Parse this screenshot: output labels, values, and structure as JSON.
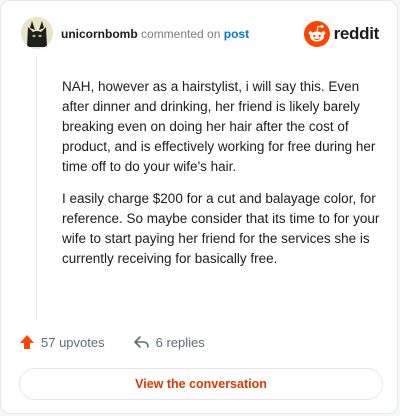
{
  "header": {
    "username": "unicornbomb",
    "action_text": "commented on",
    "post_link_label": "post",
    "logo_text": "reddit"
  },
  "comment": {
    "paragraphs": [
      "NAH, however as a hairstylist, i will say this. Even after dinner and drinking, her friend is likely barely breaking even on doing her hair after the cost of product, and is effectively working for free during her time off to do your wife's hair.",
      "I easily charge $200 for a cut and balayage color, for reference. So maybe consider that its time to for your wife to start paying her friend for the services she is currently receiving for basically free."
    ]
  },
  "footer": {
    "upvotes_label": "57 upvotes",
    "replies_label": "6 replies",
    "view_button_label": "View the conversation"
  },
  "colors": {
    "accent": "#ff4500",
    "link": "#0079d3",
    "button_text": "#d93a00",
    "muted": "#576f76"
  },
  "icons": {
    "avatar": "black-cat-avatar",
    "logo": "reddit-snoo-icon",
    "upvote": "upvote-arrow-icon",
    "reply": "reply-arrow-icon"
  }
}
